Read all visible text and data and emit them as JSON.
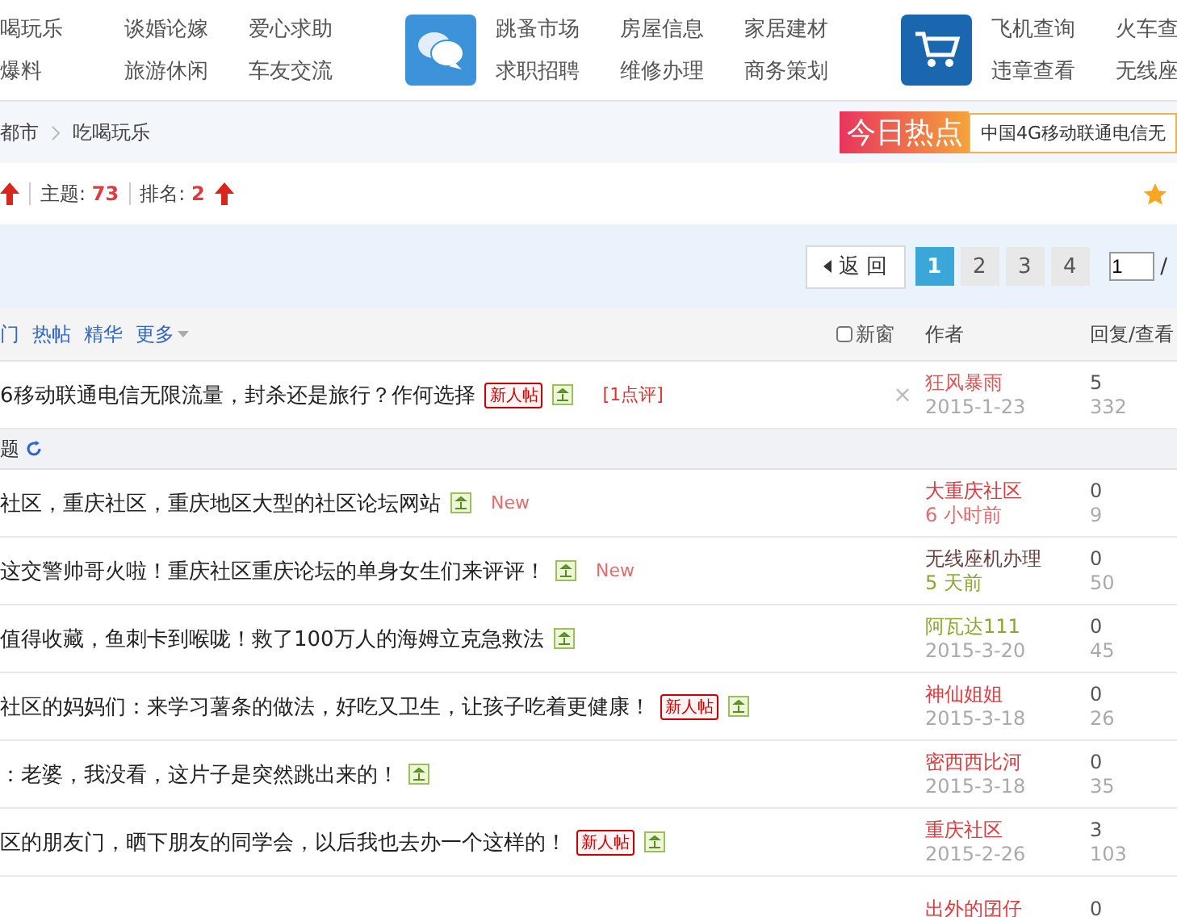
{
  "nav_groups": [
    {
      "kind": "plain",
      "links": [
        "喝玩乐",
        "谈婚论嫁",
        "爱心求助",
        "爆料",
        "旅游休闲",
        "车友交流"
      ]
    },
    {
      "kind": "chat",
      "links": [
        "跳蚤市场",
        "房屋信息",
        "家居建材",
        "求职招聘",
        "维修办理",
        "商务策划"
      ]
    },
    {
      "kind": "cart",
      "links": [
        "飞机查询",
        "火车查",
        "违章查看",
        "无线座"
      ]
    }
  ],
  "breadcrumb": [
    "都市",
    "吃喝玩乐"
  ],
  "hot": {
    "label": "今日热点",
    "text": "中国4G移动联通电信无"
  },
  "stats": [
    {
      "label": "主题:",
      "value": "73"
    },
    {
      "label": "排名:",
      "value": "2"
    }
  ],
  "pagination": {
    "back": "返 回",
    "pages": [
      {
        "label": "1",
        "selected": true
      },
      {
        "label": "2",
        "selected": false
      },
      {
        "label": "3",
        "selected": false
      },
      {
        "label": "4",
        "selected": false
      }
    ],
    "input": "1",
    "separator": "/"
  },
  "filters": [
    "门",
    "热帖",
    "精华",
    "更多"
  ],
  "new_window": {
    "label": "新窗",
    "checked": false
  },
  "columns": {
    "author": "作者",
    "counts": "回复/查看"
  },
  "sticky": [
    {
      "title": "6移动联通电信无限流量，封杀还是旅行？作何选择",
      "badges": [
        {
          "kind": "new_user",
          "text": "新人帖"
        },
        {
          "kind": "image"
        },
        {
          "kind": "comment",
          "text": "[1点评]"
        }
      ],
      "close": "×",
      "author": "狂风暴雨",
      "color": "#e0575b",
      "date": {
        "text": "2015-1-23",
        "color": "#aaaaaa"
      },
      "replies": "5",
      "views": "332"
    }
  ],
  "section": {
    "label": "题"
  },
  "rows": [
    {
      "title": "社区，重庆社区，重庆地区大型的社区论坛网站",
      "badges": [
        {
          "kind": "image"
        },
        {
          "kind": "new",
          "text": "New"
        }
      ],
      "author": "大重庆社区",
      "color": "#e0393e",
      "date": {
        "text": "6 小时前",
        "color": "#e36c6c"
      },
      "replies": "0",
      "views": "9"
    },
    {
      "title": "这交警帅哥火啦！重庆社区重庆论坛的单身女生们来评评！",
      "badges": [
        {
          "kind": "image"
        },
        {
          "kind": "new",
          "text": "New"
        }
      ],
      "author": "无线座机办理",
      "color": "#6b3f3f",
      "date": {
        "text": "5 天前",
        "color": "#8aa82f"
      },
      "replies": "0",
      "views": "50"
    },
    {
      "title": "值得收藏，鱼刺卡到喉咙！救了100万人的海姆立克急救法",
      "badges": [
        {
          "kind": "image"
        }
      ],
      "author": "阿瓦达111",
      "color": "#8aa82f",
      "date": {
        "text": "2015-3-20",
        "color": "#aaaaaa"
      },
      "replies": "0",
      "views": "45"
    },
    {
      "title": "社区的妈妈们：来学习薯条的做法，好吃又卫生，让孩子吃着更健康！",
      "badges": [
        {
          "kind": "new_user",
          "text": "新人帖"
        },
        {
          "kind": "image"
        }
      ],
      "author": "神仙姐姐",
      "color": "#e0393e",
      "date": {
        "text": "2015-3-18",
        "color": "#aaaaaa"
      },
      "replies": "0",
      "views": "26"
    },
    {
      "title": "：老婆，我没看，这片子是突然跳出来的！",
      "badges": [
        {
          "kind": "image"
        }
      ],
      "author": "密西西比河",
      "color": "#e0393e",
      "date": {
        "text": "2015-3-18",
        "color": "#aaaaaa"
      },
      "replies": "0",
      "views": "35"
    },
    {
      "title": "区的朋友门，晒下朋友的同学会，以后我也去办一个这样的！",
      "badges": [
        {
          "kind": "new_user",
          "text": "新人帖"
        },
        {
          "kind": "image"
        }
      ],
      "author": "重庆社区",
      "color": "#e0393e",
      "date": {
        "text": "2015-2-26",
        "color": "#aaaaaa"
      },
      "replies": "3",
      "views": "103"
    },
    {
      "badges": [],
      "author": "出外的囝仔",
      "color": "#e0393e",
      "replies": "0"
    }
  ]
}
